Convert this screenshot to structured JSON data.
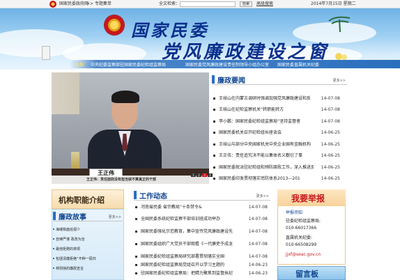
{
  "topbar": {
    "site_link": "国家民委政府网",
    "arrow": ">>",
    "topic_link": "专题集萃",
    "search_label": "全文检索：",
    "search_placeholder": "",
    "search_button": "检索",
    "advanced_search": "高级搜索",
    "date": "2014年7月15日 星期二"
  },
  "banner": {
    "title_line1": "国家民委",
    "title_line2": "党风廉政建设之窗"
  },
  "linkbar": {
    "label": "主办：",
    "links": [
      "中央纪委监察部驻国家民委纪检组监察局",
      "国家民委党风廉政建设责任制领导小组办公室",
      "国家民委直属机关纪委"
    ]
  },
  "photo": {
    "nameplate": "王正伟",
    "caption": "王正伟：责任面前没有担当就不算真正的干部",
    "dots": [
      "1",
      "2",
      "3",
      "4"
    ]
  },
  "lianzheng": {
    "title": "廉政要闻",
    "more": "更多>>",
    "items": [
      {
        "text": "王岐山在内蒙古调研时强调加强党风廉政建设和反",
        "date": "14-07-08"
      },
      {
        "text": "王岐山在纪检监察机关“转职能转方",
        "date": "14-07-08"
      },
      {
        "text": "李小鹏：国家民委纪检组监察局“坚持监督者",
        "date": "14-07-08"
      },
      {
        "text": "国家民委机关召开纪检组长座谈会",
        "date": "14-06-25"
      },
      {
        "text": "王岐山与部分中央国家机关中央企业国有金融机构",
        "date": "14-06-25"
      },
      {
        "text": "王正伟：责任追究决不能以集体名义敷衍了事",
        "date": "14-06-25"
      },
      {
        "text": "国家民委就派驻纪检组和预防腐败工作，深入推进反",
        "date": "14-06-25"
      },
      {
        "text": "国家民委印发贯彻落实惩防体系2013—201",
        "date": "14-06-25"
      }
    ]
  },
  "jigou": {
    "label": "机构职能介绍"
  },
  "gushi": {
    "title": "廉政故事",
    "more": "更多>>",
    "items": [
      "海瑞铁面巡视少",
      "自律严谨 政改为治",
      "最他拒赠的将领",
      "包拯清廉拒绝“不种一砚归",
      "林则徐的廉政宣言"
    ]
  },
  "gongzuo": {
    "title": "工作动态",
    "more": "更多>>",
    "items": [
      {
        "text": "河南省民委 省宗教局“十条禁令&",
        "date": "14-07-08"
      },
      {
        "text": "全国民委系统纪检监察干部培训班成功举办",
        "date": "14-07-08"
      },
      {
        "text": "国家民委强化示范教育，集中宣传党风廉政建设先",
        "date": "14-07-08"
      },
      {
        "text": "国家民委组织广大党员干部观看《一代廉吏于成龙",
        "date": "14-07-08"
      },
      {
        "text": "国家民委纪检组监察局研究部署贯彻落实全国",
        "date": "14-07-08"
      },
      {
        "text": "国家民委纪检组监察局党组召开以学习主题的",
        "date": "14-06-23"
      },
      {
        "text": "驻国家民委纪检组监察局：把精力聚焦到监督执纪",
        "date": "14-06-23"
      }
    ]
  },
  "report": {
    "title": "我要举报",
    "lines": [
      "举报须知",
      "驻委纪检组监察局:",
      "010-66017366",
      "直属机关纪委:",
      "010-66508299"
    ],
    "email": "jjxf@seac.gov.cn"
  },
  "liuyan": {
    "label": "留言板"
  }
}
